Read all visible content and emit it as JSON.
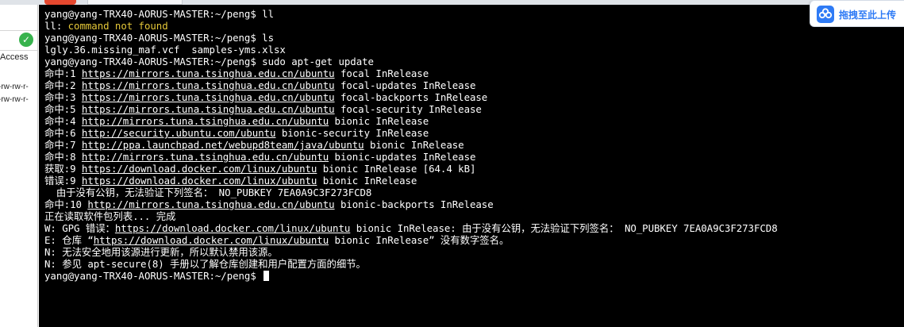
{
  "left_panel": {
    "access_label": "Access",
    "perm_1": "-rw-rw-r-",
    "perm_2": "-rw-rw-r-"
  },
  "upload_widget": {
    "label": "拖拽至此上传"
  },
  "terminal": {
    "lines": [
      {
        "parts": [
          {
            "t": "yang@yang-TRX40-AORUS-MASTER:~/peng$ ll"
          }
        ]
      },
      {
        "parts": [
          {
            "t": "ll: "
          },
          {
            "t": "command not found",
            "c": "yellow"
          }
        ]
      },
      {
        "parts": [
          {
            "t": "yang@yang-TRX40-AORUS-MASTER:~/peng$ ls"
          }
        ]
      },
      {
        "parts": [
          {
            "t": "lgly.36.missing_maf.vcf  samples-yms.xlsx"
          }
        ]
      },
      {
        "parts": [
          {
            "t": "yang@yang-TRX40-AORUS-MASTER:~/peng$ sudo apt-get update"
          }
        ]
      },
      {
        "parts": [
          {
            "t": "命中:1 "
          },
          {
            "t": "https://mirrors.tuna.tsinghua.edu.cn/ubuntu",
            "c": "link"
          },
          {
            "t": " focal InRelease"
          }
        ]
      },
      {
        "parts": [
          {
            "t": "命中:2 "
          },
          {
            "t": "https://mirrors.tuna.tsinghua.edu.cn/ubuntu",
            "c": "link"
          },
          {
            "t": " focal-updates InRelease"
          }
        ]
      },
      {
        "parts": [
          {
            "t": "命中:3 "
          },
          {
            "t": "https://mirrors.tuna.tsinghua.edu.cn/ubuntu",
            "c": "link"
          },
          {
            "t": " focal-backports InRelease"
          }
        ]
      },
      {
        "parts": [
          {
            "t": "命中:5 "
          },
          {
            "t": "https://mirrors.tuna.tsinghua.edu.cn/ubuntu",
            "c": "link"
          },
          {
            "t": " focal-security InRelease"
          }
        ]
      },
      {
        "parts": [
          {
            "t": "命中:4 "
          },
          {
            "t": "http://mirrors.tuna.tsinghua.edu.cn/ubuntu",
            "c": "link"
          },
          {
            "t": " bionic InRelease"
          }
        ]
      },
      {
        "parts": [
          {
            "t": "命中:6 "
          },
          {
            "t": "http://security.ubuntu.com/ubuntu",
            "c": "link"
          },
          {
            "t": " bionic-security InRelease"
          }
        ]
      },
      {
        "parts": [
          {
            "t": "命中:7 "
          },
          {
            "t": "http://ppa.launchpad.net/webupd8team/java/ubuntu",
            "c": "link"
          },
          {
            "t": " bionic InRelease"
          }
        ]
      },
      {
        "parts": [
          {
            "t": "命中:8 "
          },
          {
            "t": "http://mirrors.tuna.tsinghua.edu.cn/ubuntu",
            "c": "link"
          },
          {
            "t": " bionic-updates InRelease"
          }
        ]
      },
      {
        "parts": [
          {
            "t": "获取:9 "
          },
          {
            "t": "https://download.docker.com/linux/ubuntu",
            "c": "link"
          },
          {
            "t": " bionic InRelease [64.4 kB]"
          }
        ]
      },
      {
        "parts": [
          {
            "t": "错误:9 "
          },
          {
            "t": "https://download.docker.com/linux/ubuntu",
            "c": "link"
          },
          {
            "t": " bionic InRelease"
          }
        ]
      },
      {
        "parts": [
          {
            "t": "  由于没有公钥，无法验证下列签名： NO_PUBKEY 7EA0A9C3F273FCD8"
          }
        ]
      },
      {
        "parts": [
          {
            "t": "命中:10 "
          },
          {
            "t": "http://mirrors.tuna.tsinghua.edu.cn/ubuntu",
            "c": "link"
          },
          {
            "t": " bionic-backports InRelease"
          }
        ]
      },
      {
        "parts": [
          {
            "t": "正在读取软件包列表... 完成"
          }
        ]
      },
      {
        "parts": [
          {
            "t": "W: GPG 错误："
          },
          {
            "t": "https://download.docker.com/linux/ubuntu",
            "c": "link"
          },
          {
            "t": " bionic InRelease: 由于没有公钥，无法验证下列签名： NO_PUBKEY 7EA0A9C3F273FCD8"
          }
        ]
      },
      {
        "parts": [
          {
            "t": "E: 仓库 “"
          },
          {
            "t": "https://download.docker.com/linux/ubuntu",
            "c": "link"
          },
          {
            "t": " bionic InRelease” 没有数字签名。"
          }
        ]
      },
      {
        "parts": [
          {
            "t": "N: 无法安全地用该源进行更新，所以默认禁用该源。"
          }
        ]
      },
      {
        "parts": [
          {
            "t": "N: 参见 apt-secure(8) 手册以了解仓库创建和用户配置方面的细节。"
          }
        ]
      },
      {
        "parts": [
          {
            "t": "yang@yang-TRX40-AORUS-MASTER:~/peng$ "
          }
        ],
        "cursor": true
      }
    ]
  }
}
